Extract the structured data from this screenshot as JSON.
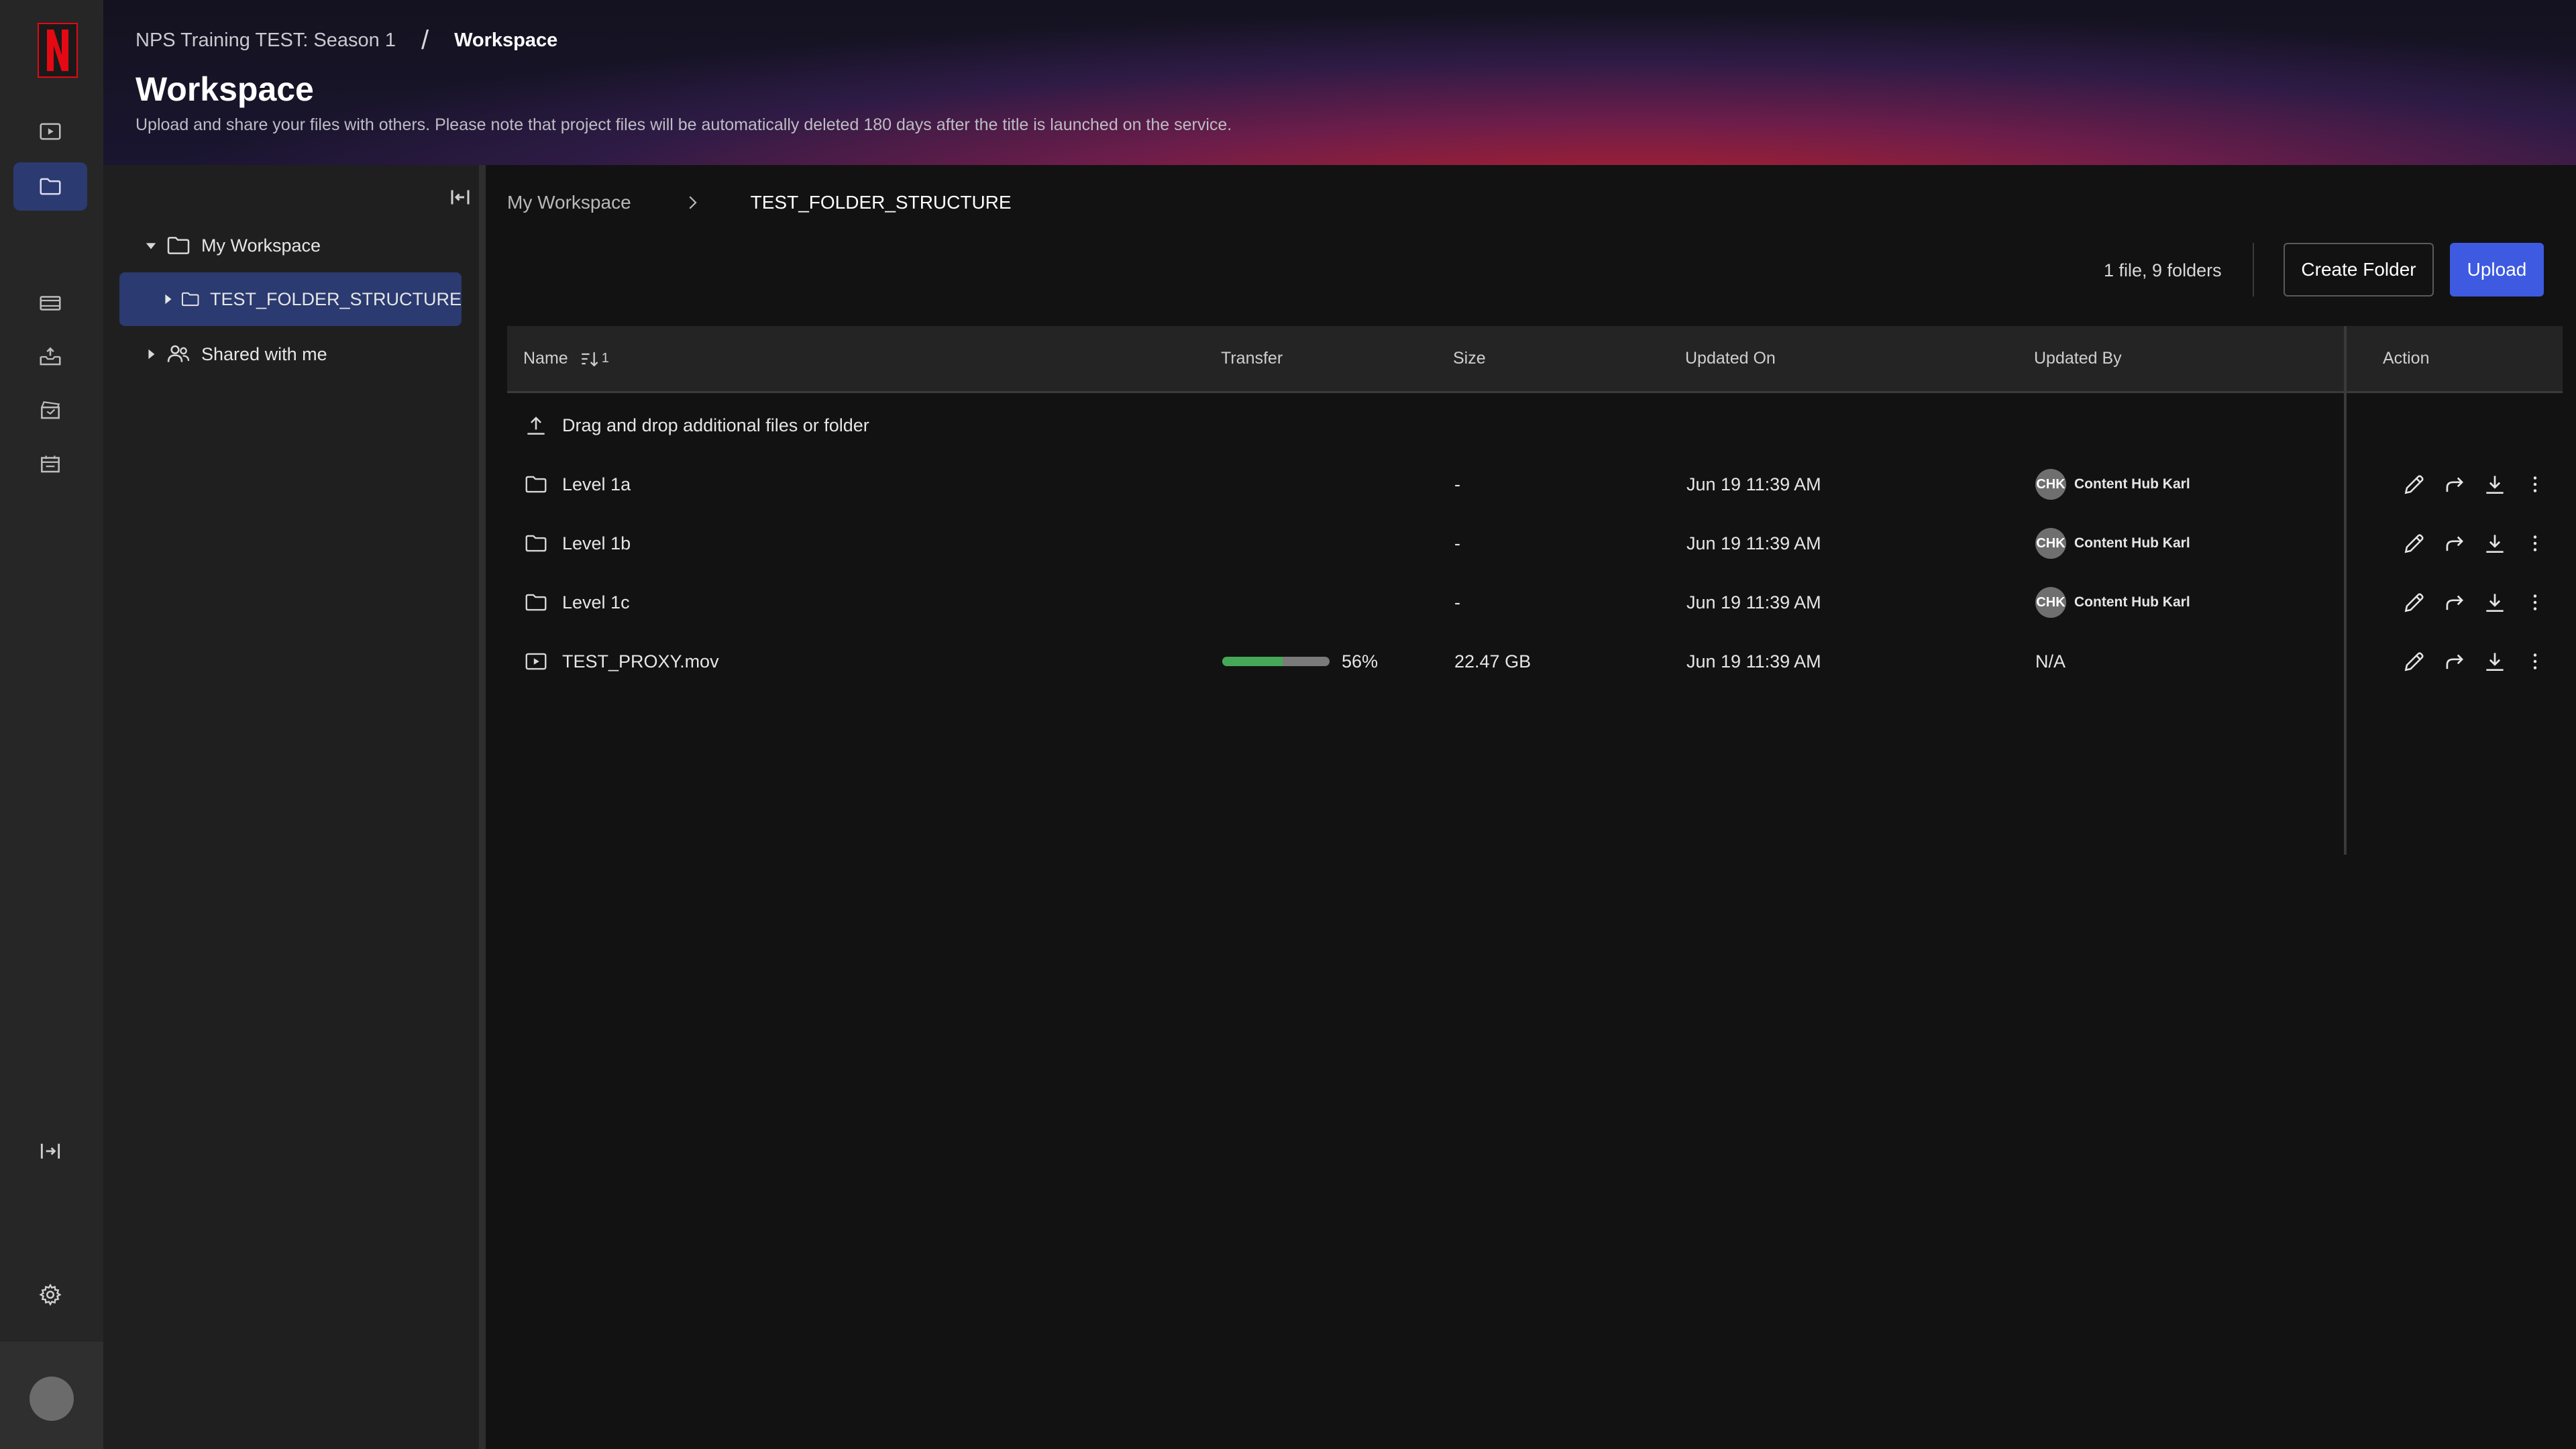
{
  "colors": {
    "accent": "#3d5ae0",
    "selected_bg": "#2b3a70",
    "progress_fill": "#46a758",
    "brand_red": "#e50914"
  },
  "rail": {
    "icons": [
      "play-square-icon",
      "folder-icon",
      "film-strip-icon",
      "inbox-upload-icon",
      "clapperboard-icon",
      "calendar-box-icon",
      "expand-icon",
      "gear-icon"
    ]
  },
  "header": {
    "breadcrumb_parent": "NPS Training TEST: Season 1",
    "breadcrumb_sep": "/",
    "breadcrumb_current": "Workspace",
    "title": "Workspace",
    "subtitle": "Upload and share your files with others. Please note that project files will be automatically deleted 180 days after the title is launched on the service."
  },
  "tree": {
    "my_workspace": "My Workspace",
    "selected_folder": "TEST_FOLDER_STRUCTURE",
    "shared": "Shared with me"
  },
  "main": {
    "breadcrumb_root": "My Workspace",
    "breadcrumb_current": "TEST_FOLDER_STRUCTURE",
    "count": "1 file, 9 folders",
    "create_folder": "Create Folder",
    "upload": "Upload"
  },
  "table": {
    "columns": {
      "name": "Name",
      "sort_indicator": "1",
      "transfer": "Transfer",
      "size": "Size",
      "updated_on": "Updated On",
      "updated_by": "Updated By",
      "action": "Action"
    },
    "drop_text": "Drag and drop additional files or folder",
    "rows": [
      {
        "type": "folder",
        "name": "Level 1a",
        "size": "-",
        "updated_on": "Jun 19 11:39 AM",
        "initials": "CHK",
        "updated_by": "Content Hub Karl"
      },
      {
        "type": "folder",
        "name": "Level 1b",
        "size": "-",
        "updated_on": "Jun 19 11:39 AM",
        "initials": "CHK",
        "updated_by": "Content Hub Karl"
      },
      {
        "type": "folder",
        "name": "Level 1c",
        "size": "-",
        "updated_on": "Jun 19 11:39 AM",
        "initials": "CHK",
        "updated_by": "Content Hub Karl"
      },
      {
        "type": "video",
        "name": "TEST_PROXY.mov",
        "transfer_percent": 56,
        "transfer_label": "56%",
        "size": "22.47 GB",
        "updated_on": "Jun 19 11:39 AM",
        "updated_by": "N/A"
      }
    ]
  }
}
